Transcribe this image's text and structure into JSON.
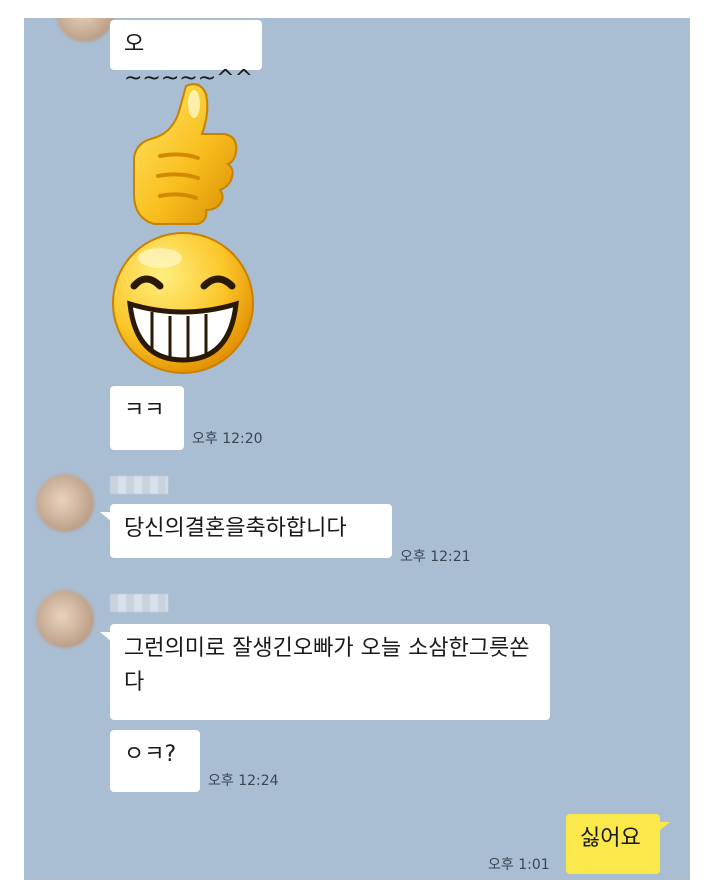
{
  "messages": [
    {
      "text": "오~~~~~^^"
    },
    {
      "text": "ㅋㅋ",
      "time": "오후 12:20"
    },
    {
      "text": "당신의결혼을축하합니다",
      "time": "오후 12:21"
    },
    {
      "text": "그런의미로 잘생긴오빠가 오늘 소삼한그릇쏜다"
    },
    {
      "text": "ㅇㅋ?",
      "time": "오후 12:24"
    },
    {
      "text": "싫어요",
      "time": "오후 1:01"
    }
  ],
  "stickers": [
    "thumbs-up-icon",
    "grinning-face-icon"
  ],
  "colors": {
    "chat_bg": "#a9bdd3",
    "my_bubble": "#fbe84a",
    "their_bubble": "#ffffff"
  }
}
